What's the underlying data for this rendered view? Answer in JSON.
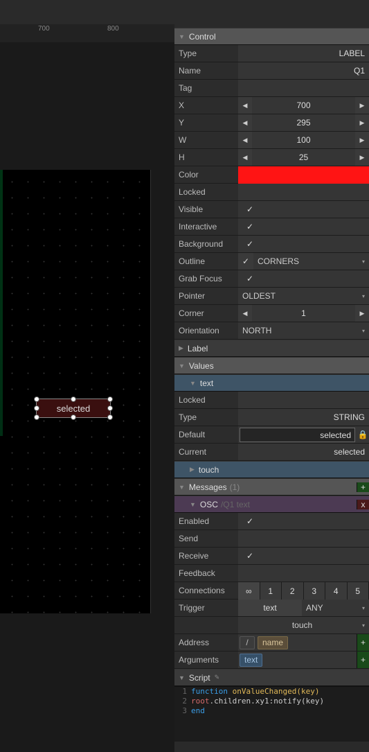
{
  "ruler": {
    "t700": "700",
    "t800": "800"
  },
  "canvas": {
    "selected_label": "selected"
  },
  "control": {
    "title": "Control",
    "type_label": "Type",
    "type": "LABEL",
    "name_label": "Name",
    "name": "Q1",
    "tag_label": "Tag",
    "x_label": "X",
    "x": "700",
    "y_label": "Y",
    "y": "295",
    "w_label": "W",
    "w": "100",
    "h_label": "H",
    "h": "25",
    "color_label": "Color",
    "color": "#ff1414",
    "locked_label": "Locked",
    "locked": false,
    "visible_label": "Visible",
    "visible": true,
    "interactive_label": "Interactive",
    "interactive": true,
    "background_label": "Background",
    "background": true,
    "outline_label": "Outline",
    "outline_on": true,
    "outline": "CORNERS",
    "grab_label": "Grab Focus",
    "grab": true,
    "pointer_label": "Pointer",
    "pointer": "OLDEST",
    "corner_label": "Corner",
    "corner": "1",
    "orientation_label": "Orientation",
    "orientation": "NORTH"
  },
  "label_section": {
    "title": "Label"
  },
  "values": {
    "title": "Values",
    "text": {
      "title": "text",
      "locked_label": "Locked",
      "locked": false,
      "type_label": "Type",
      "type": "STRING",
      "default_label": "Default",
      "default": "selected",
      "current_label": "Current",
      "current": "selected"
    },
    "touch": {
      "title": "touch"
    }
  },
  "messages": {
    "title": "Messages",
    "count": "(1)",
    "osc": {
      "title": "OSC",
      "path": "/Q1",
      "arg": "text"
    },
    "enabled_label": "Enabled",
    "enabled": true,
    "send_label": "Send",
    "send": false,
    "receive_label": "Receive",
    "receive": true,
    "feedback_label": "Feedback",
    "feedback": false,
    "connections_label": "Connections",
    "connections": {
      "inf": "∞",
      "c1": "1",
      "c2": "2",
      "c3": "3",
      "c4": "4",
      "c5": "5"
    },
    "trigger_label": "Trigger",
    "trigger_val": "text",
    "trigger_mode": "ANY",
    "trigger_touch": "touch",
    "address_label": "Address",
    "slash": "/",
    "name_tag": "name",
    "arguments_label": "Arguments",
    "text_tag": "text"
  },
  "script": {
    "title": "Script",
    "line1": {
      "kw": "function",
      "rest": " onValueChanged(key)"
    },
    "line2": {
      "root": "root",
      "rest": ".children.xy1:notify(key)"
    },
    "line3": {
      "kw": "end"
    }
  }
}
